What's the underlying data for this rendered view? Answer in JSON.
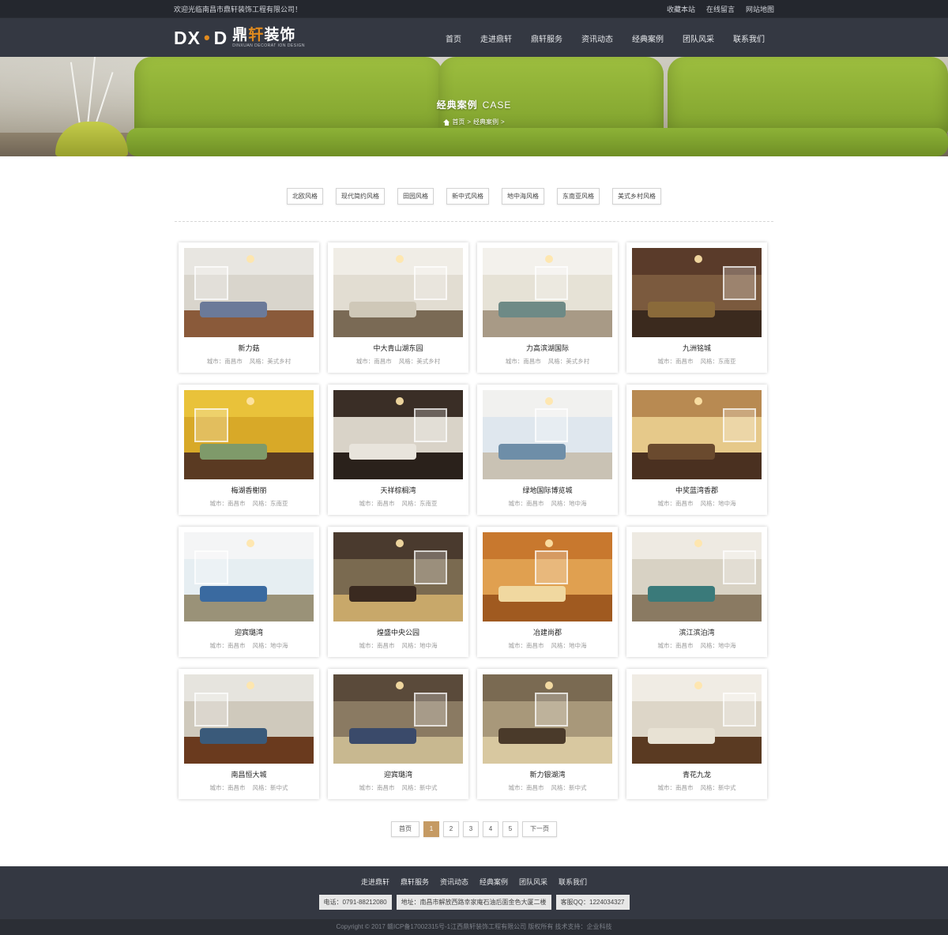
{
  "topbar": {
    "welcome": "欢迎光临南昌市鼎轩装饰工程有限公司！",
    "links": [
      "收藏本站",
      "在线留言",
      "网站地图"
    ]
  },
  "logo": {
    "mark_left": "DX",
    "mark_dot": "•",
    "mark_right": "D",
    "name_a": "鼎",
    "name_b": "轩",
    "name_c": "装饰",
    "en": "DINXUAN DECORAT ION DESIGN"
  },
  "nav": [
    "首页",
    "走进鼎轩",
    "鼎轩服务",
    "资讯动态",
    "经典案例",
    "团队风采",
    "联系我们"
  ],
  "banner": {
    "title": "经典案例",
    "title_en": "CASE",
    "crumb_home": "首页",
    "crumb_sep": ">",
    "crumb_current": "经典案例",
    "crumb_end": ">"
  },
  "filters": [
    "北欧风格",
    "现代简约风格",
    "田园风格",
    "新中式风格",
    "地中海风格",
    "东南亚风格",
    "美式乡村风格"
  ],
  "cases": [
    {
      "name": "新力菇",
      "city": "城市：南昌市",
      "style": "风格：美式乡村",
      "palette": [
        "#e8e6e1",
        "#d9d5cc",
        "#8a5a3a",
        "#6b7a99"
      ]
    },
    {
      "name": "中大青山湖东园",
      "city": "城市：南昌市",
      "style": "风格：美式乡村",
      "palette": [
        "#f0ede6",
        "#e2ddd2",
        "#7a6a55",
        "#cfc8b8"
      ]
    },
    {
      "name": "力高滨湖国际",
      "city": "城市：南昌市",
      "style": "风格：美式乡村",
      "palette": [
        "#f3f1ec",
        "#e6e2d6",
        "#a89a86",
        "#6e8a86"
      ]
    },
    {
      "name": "九洲铭城",
      "city": "城市：南昌市",
      "style": "风格：东南亚",
      "palette": [
        "#5a3b2a",
        "#7b5a3e",
        "#3b2a1e",
        "#8a6a3a"
      ]
    },
    {
      "name": "梅湖香榭丽",
      "city": "城市：南昌市",
      "style": "风格：东南亚",
      "palette": [
        "#e9c23a",
        "#d8a928",
        "#5a3a22",
        "#7f9a6a"
      ]
    },
    {
      "name": "天祥棕榈湾",
      "city": "城市：南昌市",
      "style": "风格：东南亚",
      "palette": [
        "#3a2e26",
        "#d9d3c8",
        "#2a211b",
        "#e8e4dc"
      ]
    },
    {
      "name": "绿地国际博览城",
      "city": "城市：南昌市",
      "style": "风格：地中海",
      "palette": [
        "#f1f1ef",
        "#dfe7ee",
        "#c9c2b4",
        "#6e8ea8"
      ]
    },
    {
      "name": "中奖蓝湾香郡",
      "city": "城市：南昌市",
      "style": "风格：地中海",
      "palette": [
        "#b88a52",
        "#e6c98a",
        "#4a3020",
        "#6a4a2e"
      ]
    },
    {
      "name": "迎宾璐湾",
      "city": "城市：南昌市",
      "style": "风格：地中海",
      "palette": [
        "#f4f5f6",
        "#e6eef2",
        "#9a9278",
        "#3a6aa0"
      ]
    },
    {
      "name": "煌盛中央公园",
      "city": "城市：南昌市",
      "style": "风格：地中海",
      "palette": [
        "#4a3a2e",
        "#7a6a50",
        "#c8a86a",
        "#3a2a20"
      ]
    },
    {
      "name": "冶建尚郡",
      "city": "城市：南昌市",
      "style": "风格：地中海",
      "palette": [
        "#c8782e",
        "#e0a050",
        "#a05a20",
        "#f0d8a0"
      ]
    },
    {
      "name": "滨江滨泊湾",
      "city": "城市：南昌市",
      "style": "风格：地中海",
      "palette": [
        "#eeeae2",
        "#d8d2c4",
        "#8a7a62",
        "#3a7a7a"
      ]
    },
    {
      "name": "南昌恒大城",
      "city": "城市：南昌市",
      "style": "风格：新中式",
      "palette": [
        "#e6e4de",
        "#cfc9bc",
        "#6a3a1e",
        "#3a5a7a"
      ]
    },
    {
      "name": "迎宾璐湾",
      "city": "城市：南昌市",
      "style": "风格：新中式",
      "palette": [
        "#5a4a3a",
        "#8a7a62",
        "#c8b890",
        "#3a4a6a"
      ]
    },
    {
      "name": "新力银湖湾",
      "city": "城市：南昌市",
      "style": "风格：新中式",
      "palette": [
        "#7a6a52",
        "#a8987a",
        "#d8c8a0",
        "#4a3a2a"
      ]
    },
    {
      "name": "青花九龙",
      "city": "城市：南昌市",
      "style": "风格：新中式",
      "palette": [
        "#f0ece4",
        "#ddd6c8",
        "#5a3a22",
        "#e8e2d4"
      ]
    }
  ],
  "pager": {
    "first": "首页",
    "pages": [
      "1",
      "2",
      "3",
      "4",
      "5"
    ],
    "active": 1,
    "next": "下一页"
  },
  "footer": {
    "nav": [
      "走进鼎轩",
      "鼎轩服务",
      "资讯动态",
      "经典案例",
      "团队风采",
      "联系我们"
    ],
    "phone": "电话：0791-88212080",
    "address": "地址：南昌市解放西路幸家庵石油后面金色大厦二楼",
    "qq": "客服QQ：1224034327",
    "copyright": "Copyright © 2017 赣ICP备17002315号-1江西鼎轩装饰工程有限公司 版权所有    技术支持：企业科技"
  },
  "colors": {
    "topbar": "#24272e",
    "header": "#343842",
    "accent": "#e08a1e",
    "pager_active": "#c59a63"
  }
}
